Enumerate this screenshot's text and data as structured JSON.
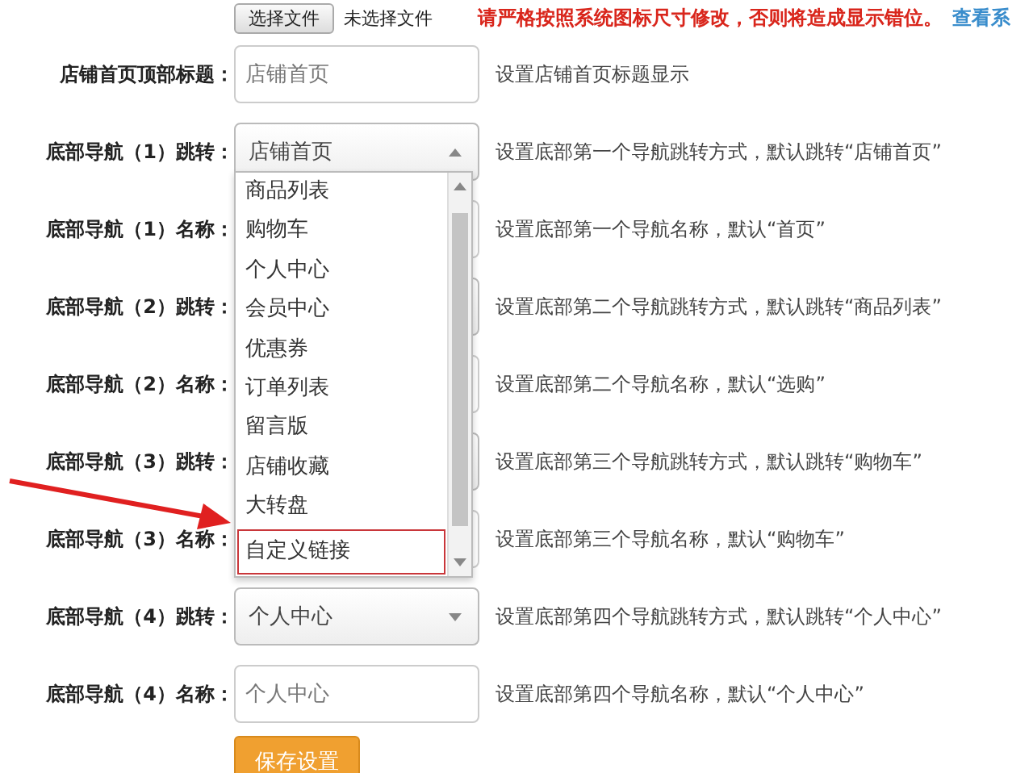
{
  "upload": {
    "button": "选择文件",
    "status": "未选择文件",
    "warning": "请严格按照系统图标尺寸修改，否则将造成显示错位。",
    "link": "查看系"
  },
  "fields": [
    {
      "label": "店铺首页顶部标题：",
      "kind": "input",
      "placeholder": "店铺首页",
      "hint": "设置店铺首页标题显示"
    },
    {
      "label": "底部导航（1）跳转：",
      "kind": "select",
      "value": "店铺首页",
      "expanded": true,
      "hint": "设置底部第一个导航跳转方式，默认跳转“店铺首页”",
      "options": [
        {
          "label": "商品列表",
          "marked": false
        },
        {
          "label": "购物车",
          "marked": false
        },
        {
          "label": "个人中心",
          "marked": false
        },
        {
          "label": "会员中心",
          "marked": false
        },
        {
          "label": "优惠券",
          "marked": false
        },
        {
          "label": "订单列表",
          "marked": false
        },
        {
          "label": "留言版",
          "marked": false
        },
        {
          "label": "店铺收藏",
          "marked": false
        },
        {
          "label": "大转盘",
          "marked": false
        },
        {
          "label": "自定义链接",
          "marked": true
        }
      ]
    },
    {
      "label": "底部导航（1）名称：",
      "kind": "input",
      "hint": "设置底部第一个导航名称，默认“首页”"
    },
    {
      "label": "底部导航（2）跳转：",
      "kind": "select",
      "expanded": false,
      "hint": "设置底部第二个导航跳转方式，默认跳转“商品列表”"
    },
    {
      "label": "底部导航（2）名称：",
      "kind": "input",
      "hint": "设置底部第二个导航名称，默认“选购”"
    },
    {
      "label": "底部导航（3）跳转：",
      "kind": "select",
      "expanded": false,
      "hint": "设置底部第三个导航跳转方式，默认跳转“购物车”"
    },
    {
      "label": "底部导航（3）名称：",
      "kind": "input",
      "hint": "设置底部第三个导航名称，默认“购物车”"
    },
    {
      "label": "底部导航（4）跳转：",
      "kind": "select",
      "value": "个人中心",
      "expanded": false,
      "hint": "设置底部第四个导航跳转方式，默认跳转“个人中心”"
    },
    {
      "label": "底部导航（4）名称：",
      "kind": "input",
      "placeholder": "个人中心",
      "hint": "设置底部第四个导航名称，默认“个人中心”"
    }
  ],
  "save_button": "保存设置"
}
